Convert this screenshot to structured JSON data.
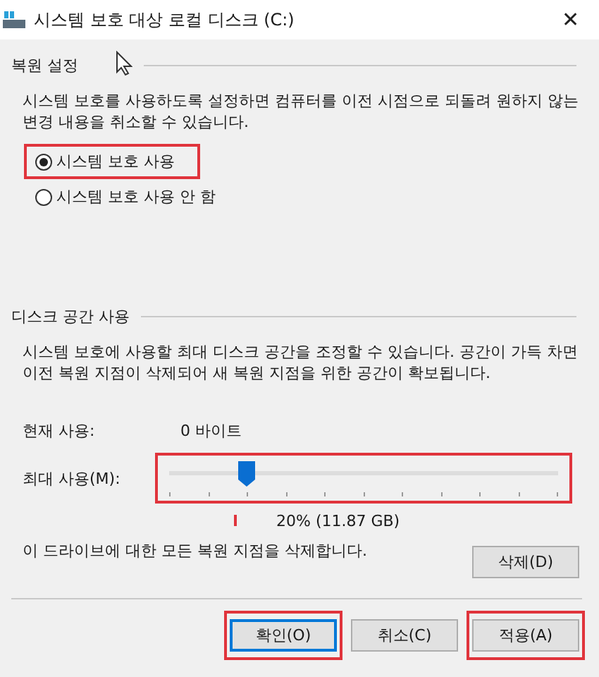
{
  "window": {
    "title": "시스템 보호 대상 로컬 디스크 (C:)",
    "close": "✕"
  },
  "restore_settings": {
    "heading": "복원 설정",
    "description": "시스템 보호를 사용하도록 설정하면 컴퓨터를 이전 시점으로 되돌려 원하지 않는 변경 내용을 취소할 수 있습니다.",
    "options": [
      {
        "label": "시스템 보호 사용",
        "selected": true,
        "highlighted": true
      },
      {
        "label": "시스템 보호 사용 안 함",
        "selected": false,
        "highlighted": false
      }
    ]
  },
  "disk_usage": {
    "heading": "디스크 공간 사용",
    "description": "시스템 보호에 사용할 최대 디스크 공간을 조정할 수 있습니다. 공간이 가득 차면 이전 복원 지점이 삭제되어 새 복원 지점을 위한 공간이 확보됩니다.",
    "current_label": "현재 사용:",
    "current_value": "0 바이트",
    "max_label": "최대 사용(M):",
    "slider": {
      "level": 0.2,
      "highlighted": true
    },
    "max_reading": "20% (11.87 GB)",
    "delete_text": "이 드라이브에 대한 모든 복원 지점을 삭제합니다.",
    "delete_button": "삭제(D)"
  },
  "buttons": [
    {
      "label": "확인(O)",
      "default": true,
      "highlighted": true
    },
    {
      "label": "취소(C)",
      "default": false,
      "highlighted": false
    },
    {
      "label": "적용(A)",
      "default": false,
      "highlighted": true
    }
  ]
}
